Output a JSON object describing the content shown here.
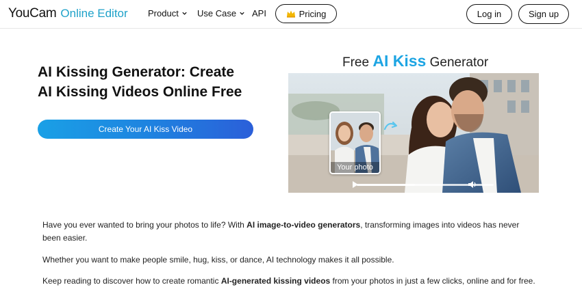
{
  "header": {
    "logo_brand": "YouCam",
    "logo_product": "Online Editor",
    "nav": [
      {
        "label": "Product"
      },
      {
        "label": "Use Case"
      },
      {
        "label": "API"
      }
    ],
    "pricing_label": "Pricing",
    "login_label": "Log in",
    "signup_label": "Sign up"
  },
  "hero": {
    "title_line1": "AI Kissing Generator: Create",
    "title_line2": "AI Kissing Videos Online Free",
    "cta_label": "Create Your AI Kiss Video"
  },
  "banner": {
    "title_prefix": "Free",
    "title_accent": "AI Kiss",
    "title_suffix": "Generator",
    "thumb_label": "Your photo"
  },
  "content": {
    "p1_a": "Have you ever wanted to bring your photos to life? With ",
    "p1_bold": "AI image-to-video generators",
    "p1_b": ", transforming images into videos has never been easier.",
    "p2": "Whether you want to make people smile, hug, kiss, or dance, AI technology makes it all possible.",
    "p3_a": "Keep reading to discover how to create romantic ",
    "p3_bold": "AI-generated kissing videos",
    "p3_b": " from your photos in just a few clicks, online and for free."
  },
  "colors": {
    "accent": "#1ea5e3",
    "cta_start": "#1aa0e6",
    "cta_end": "#2b5fd9"
  },
  "icons": [
    "chevron-down-icon",
    "crown-icon",
    "arrow-icon",
    "play-icon",
    "volume-icon"
  ]
}
